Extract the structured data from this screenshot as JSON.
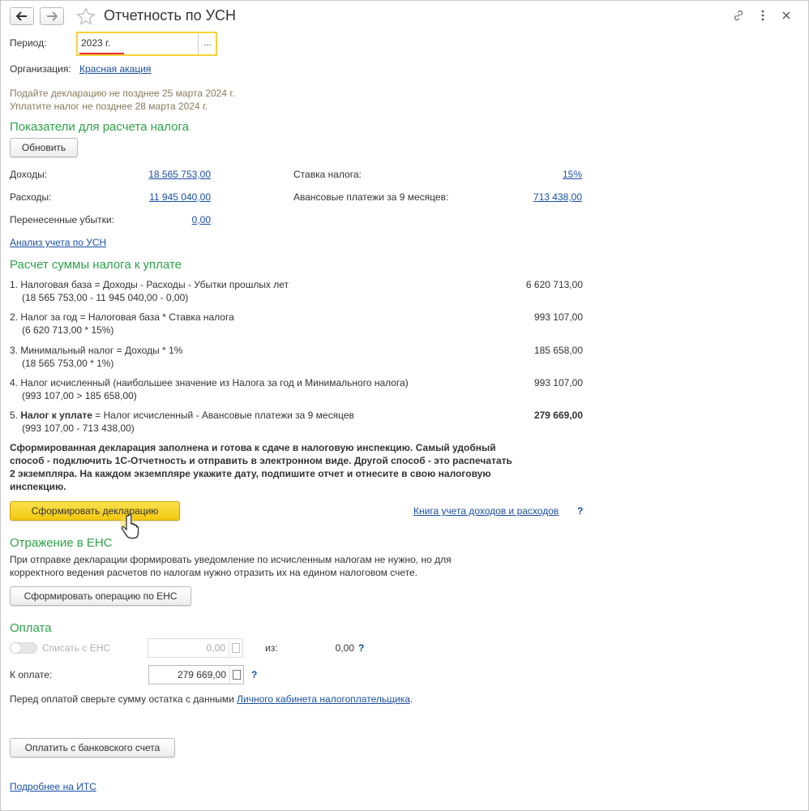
{
  "window": {
    "title": "Отчетность по УСН",
    "back_icon": "arrow-left-icon",
    "forward_icon": "arrow-right-icon",
    "star_icon": "star-icon",
    "link_icon": "link-icon",
    "more_icon": "more-icon",
    "close_icon": "close-icon"
  },
  "period": {
    "label": "Период:",
    "value": "2023 г.",
    "select_label": "..."
  },
  "organization": {
    "label": "Организация:",
    "value": "Красная акация"
  },
  "notices": {
    "line1": "Подайте декларацию не позднее 25 марта 2024 г.",
    "line2": "Уплатите налог не позднее 28 марта 2024 г."
  },
  "indicators": {
    "heading": "Показатели для расчета налога",
    "refresh_label": "Обновить",
    "income_label": "Доходы:",
    "income_value": "18 565 753,00",
    "expenses_label": "Расходы:",
    "expenses_value": "11 945 040,00",
    "losses_label": "Перенесенные убытки:",
    "losses_value": "0,00",
    "rate_label": "Ставка налога:",
    "rate_value": "15%",
    "advance_label": "Авансовые платежи за 9 месяцев:",
    "advance_value": "713 438,00",
    "analysis_link": "Анализ учета по УСН"
  },
  "calculation": {
    "heading": "Расчет суммы налога к уплате",
    "rows": [
      {
        "text": "1. Налоговая база = Доходы - Расходы - Убытки прошлых лет",
        "detail": "(18 565 753,00 - 11 945 040,00 - 0,00)",
        "value": "6 620 713,00"
      },
      {
        "text": "2. Налог за год = Налоговая база * Ставка налога",
        "detail": "(6 620 713,00 * 15%)",
        "value": "993 107,00"
      },
      {
        "text": "3. Минимальный налог = Доходы * 1%",
        "detail": "(18 565 753,00 * 1%)",
        "value": "185 658,00"
      },
      {
        "text": "4. Налог исчисленный (наибольшее значение из Налога за год и Минимального налога)",
        "detail": "(993 107,00 > 185 658,00)",
        "value": "993 107,00"
      }
    ],
    "row5_prefix": "5. ",
    "row5_bold": "Налог к уплате",
    "row5_rest": " = Налог исчисленный - Авансовые платежи за 9 месяцев",
    "row5_detail": "(993 107,00 - 713 438,00)",
    "row5_value": "279 669,00"
  },
  "declaration": {
    "message_line1": "Сформированная декларация заполнена и готова к сдаче в налоговую инспекцию. Самый удобный",
    "message_line2": "способ - подключить 1С-Отчетность и отправить в электронном виде. Другой способ - это распечатать",
    "message_line3": "2 экземпляра. На каждом экземпляре укажите дату, подпишите отчет и отнесите в свою налоговую",
    "message_line4": "инспекцию.",
    "form_button": "Сформировать декларацию",
    "book_link": "Книга учета доходов и расходов",
    "help": "?"
  },
  "ens": {
    "heading": "Отражение в ЕНС",
    "text_line1": "При отправке декларации формировать уведомление по исчисленным налогам не нужно, но для",
    "text_line2": "корректного ведения расчетов по налогам нужно отразить их на едином налоговом счете.",
    "button": "Сформировать операцию по ЕНС"
  },
  "payment": {
    "heading": "Оплата",
    "toggle_label": "Списать с ЕНС",
    "toggle_value": "0,00",
    "of_label": "из:",
    "of_value": "0,00",
    "help": "?",
    "topay_label": "К оплате:",
    "topay_value": "279 669,00",
    "topay_help": "?",
    "note_prefix": "Перед оплатой сверьте сумму остатка с данными ",
    "note_link": "Личного кабинета налогоплательщика",
    "note_suffix": ".",
    "bank_button": "Оплатить с банковского счета"
  },
  "footer": {
    "its_link": "Подробнее на ИТС"
  }
}
